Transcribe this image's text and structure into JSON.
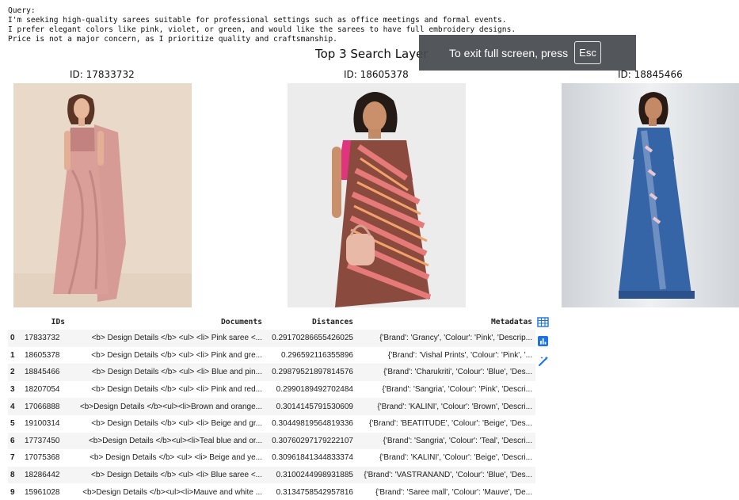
{
  "query": {
    "text": "Query:\nI'm seeking high-quality sarees suitable for professional settings such as office meetings and formal events.\nI prefer elegant colors like pink, violet, or green, and would like the sarees to have full embroidery designs.\nPrice is not a major concern, as I prioritize quality and craftsmanship."
  },
  "figure": {
    "title": "Top 3 Search Layer",
    "images": [
      {
        "id_label": "ID: 17833732"
      },
      {
        "id_label": "ID: 18605378"
      },
      {
        "id_label": "ID: 18845466"
      }
    ]
  },
  "fullscreen": {
    "message": "To exit full screen, press",
    "key": "Esc"
  },
  "table": {
    "headers": [
      "",
      "IDs",
      "Documents",
      "Distances",
      "Metadatas"
    ],
    "rows": [
      [
        "0",
        "17833732",
        "<b> Design Details </b> <ul> <li> Pink saree <...",
        "0.29170286655426025",
        "{'Brand': 'Grancy', 'Colour': 'Pink', 'Descrip..."
      ],
      [
        "1",
        "18605378",
        "<b> Design Details </b> <ul> <li> Pink and gre...",
        "0.296592116355896",
        "{'Brand': 'Vishal Prints', 'Colour': 'Pink', '..."
      ],
      [
        "2",
        "18845466",
        "<b> Design Details </b> <ul> <li> Blue and pin...",
        "0.29879521897814576",
        "{'Brand': 'Charukriti', 'Colour': 'Blue', 'Des..."
      ],
      [
        "3",
        "18207054",
        "<b> Design Details </b> <ul> <li> Pink and red...",
        "0.2990189492702484",
        "{'Brand': 'Sangria', 'Colour': 'Pink', 'Descri..."
      ],
      [
        "4",
        "17066888",
        "<b>Design Details </b><ul><li>Brown and orange...",
        "0.3014145791530609",
        "{'Brand': 'KALINI', 'Colour': 'Brown', 'Descri..."
      ],
      [
        "5",
        "19100314",
        "<b> Design Details </b> <ul> <li> Beige and gr...",
        "0.30449819564819336",
        "{'Brand': 'BEATITUDE', 'Colour': 'Beige', 'Des..."
      ],
      [
        "6",
        "17737450",
        "<b>Design Details </b><ul><li>Teal blue and or...",
        "0.30760297179222107",
        "{'Brand': 'Sangria', 'Colour': 'Teal', 'Descri..."
      ],
      [
        "7",
        "17075368",
        "<b> Design Details </b> <ul> <li> Beige and ye...",
        "0.30961841344833374",
        "{'Brand': 'KALINI', 'Colour': 'Beige', 'Descri..."
      ],
      [
        "8",
        "18286442",
        "<b> Design Details </b> <ul> <li> Blue saree <...",
        "0.3100244998931885",
        "{'Brand': 'VASTRANAND', 'Colour': 'Blue', 'Des..."
      ],
      [
        "9",
        "15961028",
        "<b>Design Details </b><ul><li>Mauve and white ...",
        "0.3134758542957816",
        "{'Brand': 'Saree mall', 'Colour': 'Mauve', 'De..."
      ]
    ]
  },
  "toolbar": {
    "icons": [
      "table-icon",
      "chart-icon",
      "magic-wand-icon"
    ],
    "accent": "#1a73e8"
  }
}
